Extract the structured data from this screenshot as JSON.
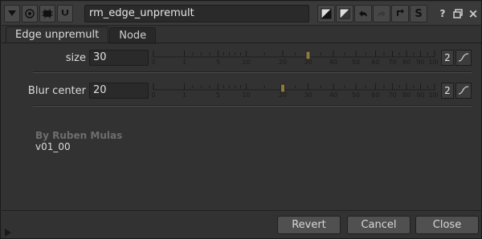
{
  "node_name": "rm_edge_unpremult",
  "tabs": [
    "Edge unpremult",
    "Node"
  ],
  "knobs": [
    {
      "label": "size",
      "value": "30",
      "slider_value": 30,
      "views": "2"
    },
    {
      "label": "Blur center",
      "value": "20",
      "slider_value": 20,
      "views": "2"
    }
  ],
  "slider_ticks": [
    "0",
    "1",
    "5",
    "10",
    "20",
    "30",
    "40",
    "50",
    "60",
    "70",
    "80",
    "90",
    "100"
  ],
  "credit": {
    "author": "By Ruben Mulas",
    "version": "v01_00"
  },
  "buttons": {
    "revert": "Revert",
    "cancel": "Cancel",
    "close": "Close"
  },
  "title_icons": [
    "collapse-triangle-icon",
    "center-node-icon",
    "node-color-icon",
    "hide-input-icon"
  ],
  "toolbar_icons": [
    "undo-history-icon",
    "reset-icon",
    "undo-icon",
    "redo-icon",
    "revert-icon",
    "S-icon"
  ],
  "window_icons": [
    "help-icon",
    "float-icon",
    "close-icon"
  ],
  "help_label": "?",
  "close_label": "×",
  "colors": {
    "panel": "#323232",
    "field": "#2a2a2a",
    "slider_handle": "#8a7a4a"
  }
}
